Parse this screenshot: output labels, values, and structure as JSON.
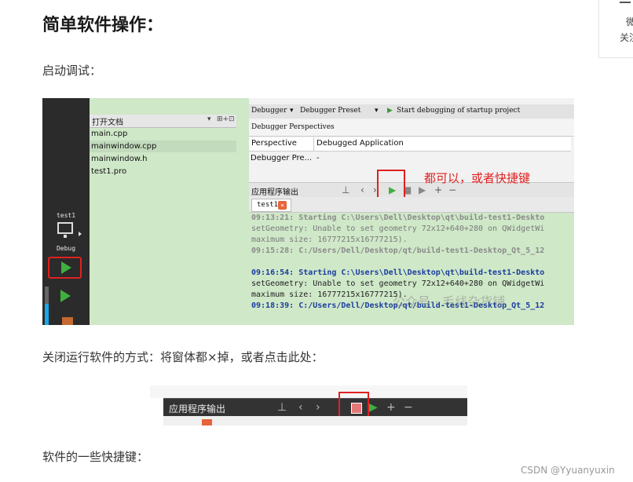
{
  "heading": "简单软件操作：",
  "para_debug": "启动调试：",
  "para_close": "关闭运行软件的方式：将窗体都×掉，或者点击此处：",
  "para_shortcuts": "软件的一些快捷键：",
  "side_widget": {
    "line1": "微",
    "line2": "关注"
  },
  "screenshot1": {
    "mode_label_top": "test1",
    "mode_label_debug": "Debug",
    "open_docs_title": "打开文档",
    "open_docs_icons": [
      "▾",
      "⊞+",
      "⊡"
    ],
    "docs": [
      "main.cpp",
      "mainwindow.cpp",
      "mainwindow.h",
      "test1.pro"
    ],
    "debugger_toolbar": {
      "debugger": "Debugger",
      "preset": "Debugger Preset",
      "start": "Start debugging of startup project"
    },
    "perspectives_label": "Debugger Perspectives",
    "table_headers": [
      "Perspective",
      "Debugged Application"
    ],
    "table_row": [
      "Debugger Pre...",
      "-"
    ],
    "output_title": "应用程序输出",
    "annotation": "都可以，或者快捷键",
    "tab_label": "test1",
    "tab_close": "×",
    "console_lines": [
      {
        "text": "09:13:21: Starting C:\\Users\\Dell\\Desktop\\qt\\build-test1-Deskto",
        "style": "dimb"
      },
      {
        "text": "setGeometry: Unable to set geometry 72x12+640+280 on QWidgetWi",
        "style": "dim"
      },
      {
        "text": "maximum size: 16777215x16777215).",
        "style": "dim"
      },
      {
        "text": "09:15:28: C:/Users/Dell/Desktop/qt/build-test1-Desktop_Qt_5_12",
        "style": "dimb"
      },
      {
        "text": "",
        "style": "dim"
      },
      {
        "text": "09:16:54: Starting C:\\Users\\Dell\\Desktop\\qt\\build-test1-Deskto",
        "style": "blue"
      },
      {
        "text": "setGeometry: Unable to set geometry 72x12+640+280 on QWidgetWi",
        "style": "dark"
      },
      {
        "text": "maximum size: 16777215x16777215).",
        "style": "dark"
      },
      {
        "text": "09:18:39: C:/Users/Dell/Desktop/qt/build-test1-Desktop_Qt_5_12",
        "style": "blue"
      }
    ],
    "watermark": "公众号 · 毛线杂货铺"
  },
  "screenshot2": {
    "output_title": "应用程序输出"
  },
  "footer_watermark": "CSDN @Yyuanyuxin",
  "colors": {
    "red_annotation": "#e02020",
    "run_green": "#3fb03f",
    "console_bg": "#cfe8c8"
  }
}
